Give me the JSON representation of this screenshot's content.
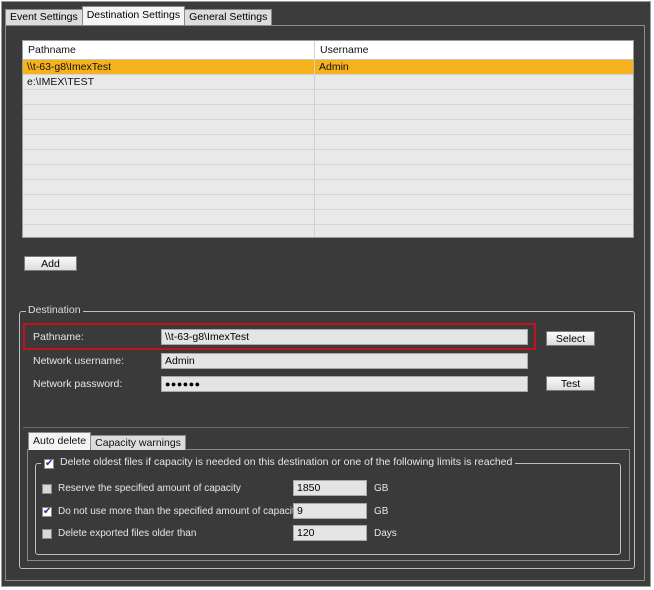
{
  "tabs": [
    "Event Settings",
    "Destination Settings",
    "General Settings"
  ],
  "active_tab": "Destination Settings",
  "grid": {
    "columns": [
      "Pathname",
      "Username"
    ],
    "rows": [
      {
        "pathname": "\\\\t-63-g8\\ImexTest",
        "username": "Admin",
        "selected": true
      },
      {
        "pathname": "e:\\IMEX\\TEST",
        "username": "",
        "selected": false
      }
    ],
    "empty_rows": 11
  },
  "add_button": "Add",
  "destination": {
    "legend": "Destination",
    "pathname_label": "Pathname:",
    "pathname_value": "\\\\t-63-g8\\ImexTest",
    "select_button": "Select",
    "username_label": "Network username:",
    "username_value": "Admin",
    "password_label": "Network password:",
    "password_value": "●●●●●●",
    "test_button": "Test"
  },
  "inner_tabs": [
    "Auto delete",
    "Capacity warnings"
  ],
  "auto_delete": {
    "main_checkbox_label": "Delete oldest files if capacity is needed on this destination or one of the following limits is reached",
    "main_checked": true,
    "options": [
      {
        "label": "Reserve the specified amount of capacity",
        "checked": false,
        "value": "1850",
        "unit": "GB"
      },
      {
        "label": "Do not use more than the specified amount of capacity",
        "checked": true,
        "value": "9",
        "unit": "GB"
      },
      {
        "label": "Delete exported files older than",
        "checked": false,
        "value": "120",
        "unit": "Days"
      }
    ]
  },
  "colors": {
    "selection": "#f5b21d",
    "highlight_border": "#c0141a",
    "panel_bg": "#3a3a3a"
  }
}
